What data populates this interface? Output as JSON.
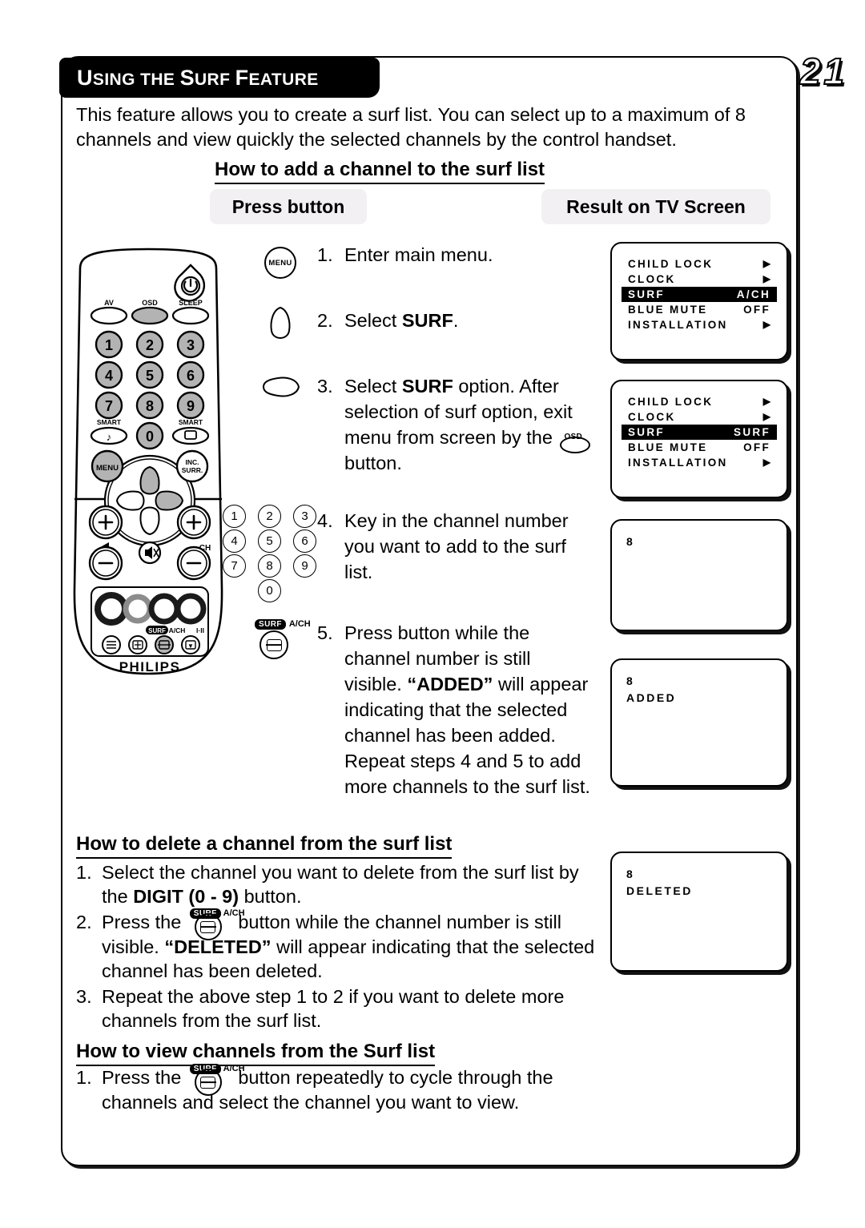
{
  "page": {
    "title_caps_1": "U",
    "title_rest_1": "SING",
    "title_caps_2": "THE",
    "title_caps_3": "S",
    "title_rest_3": "URF",
    "title_caps_4": "F",
    "title_rest_4": "EATURE",
    "title_full": "USING THE SURF FEATURE",
    "number": "21"
  },
  "intro": "This feature allows you to create a surf list. You can select up to a maximum of 8 channels and view quickly the selected channels by the control handset.",
  "headings": {
    "add": "How to add a channel to the surf list",
    "delete": "How to delete a channel from the surf list",
    "view": "How to view channels from the Surf list"
  },
  "columns": {
    "press_button": "Press button",
    "result_on_tv": "Result on TV Screen"
  },
  "steps": [
    {
      "num": "1.",
      "text": "Enter main menu.",
      "icon": "menu-button-icon"
    },
    {
      "num": "2.",
      "text": "Select SURF.",
      "icon": "cursor-up-button-icon"
    },
    {
      "num": "3.",
      "text": "Select SURF option. After selection of surf option, exit menu from screen by the OSD button.",
      "icon": "cursor-right-button-icon"
    },
    {
      "num": "4.",
      "text": "Key in the channel number you want to add to the surf list.",
      "icon": "digit-keypad-icon"
    },
    {
      "num": "5.",
      "text": "Press button while the channel number is still visible. “ADDED” will appear indicating that the selected channel has been added. Repeat steps 4 and 5 to add more channels to the surf list.",
      "icon": "surf-ach-button-icon"
    }
  ],
  "step3_parts": {
    "a": "Select ",
    "b": "SURF",
    "c": " option.",
    "d": "After selection of surf option, exit menu from screen by the ",
    "e": " button."
  },
  "step5_parts": {
    "a": "Press button while the channel number is still visible. ",
    "b": "“ADDED”",
    "c": " will appear indicating that the selected channel has been added. Repeat steps 4 and 5 to add more channels to the surf list."
  },
  "step2_parts": {
    "a": "Select ",
    "b": "SURF",
    "c": "."
  },
  "step4_text": "Key in the channel number you want to add to the surf list.",
  "keypad": [
    "1",
    "2",
    "3",
    "4",
    "5",
    "6",
    "7",
    "8",
    "9",
    "0"
  ],
  "remote": {
    "brand": "PHILIPS",
    "labels": {
      "av": "AV",
      "osd": "OSD",
      "sleep": "SLEEP",
      "smart_sound": "SMART",
      "smart_picture": "SMART",
      "menu": "MENU",
      "inc_surr_1": "INC.",
      "inc_surr_2": "SURR.",
      "ch": "CH",
      "surf": "SURF",
      "ach": "A/CH",
      "i_ii": "I·II"
    },
    "digits": [
      "1",
      "2",
      "3",
      "4",
      "5",
      "6",
      "7",
      "8",
      "9",
      "0"
    ]
  },
  "button_art": {
    "menu_label": "MENU",
    "osd_label": "OSD",
    "surf_label": "SURF",
    "ach_label": "A/CH"
  },
  "tv_screens": [
    {
      "name": "main-menu-surf-ach",
      "rows": [
        {
          "label": "CHILD LOCK",
          "value": "▶",
          "selected": false,
          "value_is_arrow": true
        },
        {
          "label": "CLOCK",
          "value": "▶",
          "selected": false,
          "value_is_arrow": true
        },
        {
          "label": "SURF",
          "value": "A/CH",
          "selected": true,
          "value_is_arrow": false
        },
        {
          "label": "BLUE MUTE",
          "value": "OFF",
          "selected": false,
          "value_is_arrow": false
        },
        {
          "label": "INSTALLATION",
          "value": "▶",
          "selected": false,
          "value_is_arrow": true
        }
      ]
    },
    {
      "name": "main-menu-surf-surf",
      "rows": [
        {
          "label": "CHILD LOCK",
          "value": "▶",
          "selected": false,
          "value_is_arrow": true
        },
        {
          "label": "CLOCK",
          "value": "▶",
          "selected": false,
          "value_is_arrow": true
        },
        {
          "label": "SURF",
          "value": "SURF",
          "selected": true,
          "value_is_arrow": false
        },
        {
          "label": "BLUE MUTE",
          "value": "OFF",
          "selected": false,
          "value_is_arrow": false
        },
        {
          "label": "INSTALLATION",
          "value": "▶",
          "selected": false,
          "value_is_arrow": true
        }
      ]
    },
    {
      "name": "channel-number",
      "lines": [
        "8"
      ]
    },
    {
      "name": "channel-added",
      "lines": [
        "8",
        "ADDED"
      ]
    },
    {
      "name": "channel-deleted",
      "lines": [
        "8",
        "DELETED"
      ]
    }
  ],
  "delete_list": [
    {
      "num": "1.",
      "a": "Select the channel you want to delete from the surf list by the ",
      "b": "DIGIT (0 - 9)",
      "c": " button."
    },
    {
      "num": "2.",
      "a": "Press the ",
      "b": " button while the channel number is still visible. ",
      "c": "“DELETED”",
      "d": " will appear indicating that the selected channel has been deleted."
    },
    {
      "num": "3.",
      "a": "Repeat the above step 1 to 2 if you want to delete more channels from the surf list."
    }
  ],
  "view_list": [
    {
      "num": "1.",
      "a": "Press the ",
      "b": " button repeatedly to cycle through the channels and select the channel you want to view."
    }
  ]
}
